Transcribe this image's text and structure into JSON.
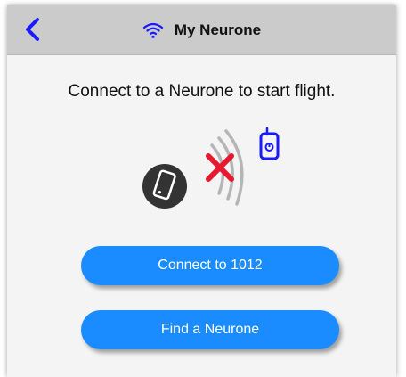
{
  "header": {
    "title": "My Neurone",
    "back_icon": "chevron-left-icon",
    "wifi_icon": "wifi-icon"
  },
  "main": {
    "headline": "Connect to a Neurone to start flight.",
    "illustration_icons": [
      "phone-icon",
      "signal-waves-icon",
      "x-mark-icon",
      "remote-controller-icon"
    ]
  },
  "buttons": {
    "connect_label": "Connect to 1012",
    "find_label": "Find a Neurone"
  },
  "colors": {
    "accent": "#1a8cff",
    "back": "#1a1aff",
    "error": "#e8192c",
    "header_bg": "#cbcbcb"
  }
}
